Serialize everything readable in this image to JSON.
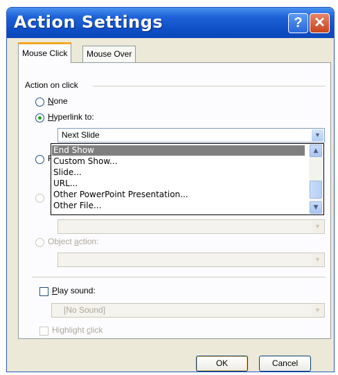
{
  "dialog": {
    "title": "Action Settings",
    "help_glyph": "?",
    "close_glyph": "✕"
  },
  "tabs": [
    {
      "label": "Mouse Click",
      "active": true
    },
    {
      "label": "Mouse Over",
      "active": false
    }
  ],
  "action_group": {
    "label": "Action on click",
    "none": {
      "prefix": "",
      "mnemonic": "N",
      "rest": "one",
      "checked": false
    },
    "hyperlink": {
      "prefix": "",
      "mnemonic": "H",
      "rest": "yperlink to:",
      "checked": true
    },
    "hyperlink_value": "Next Slide",
    "run_program_partial": "R",
    "object_action": {
      "prefix": "Object ",
      "mnemonic": "a",
      "rest": "ction:",
      "enabled": false
    }
  },
  "hyperlink_dropdown": {
    "items": [
      "End Show",
      "Custom Show...",
      "Slide...",
      "URL...",
      "Other PowerPoint Presentation...",
      "Other File..."
    ],
    "selected_index": 0
  },
  "sound": {
    "play_prefix": "",
    "play_mnemonic": "P",
    "play_rest": "lay sound:",
    "sound_value": "[No Sound]",
    "highlight_prefix": "Highlight ",
    "highlight_mnemonic": "c",
    "highlight_rest": "lick"
  },
  "buttons": {
    "ok": "OK",
    "cancel": "Cancel"
  },
  "icons": {
    "dropdown_arrow": "▼",
    "scroll_up": "▲",
    "scroll_down": "▼"
  },
  "colors": {
    "titlebar": "#0a47b8",
    "tab_accent": "#f5a623",
    "selection": "#7f7f7f"
  }
}
